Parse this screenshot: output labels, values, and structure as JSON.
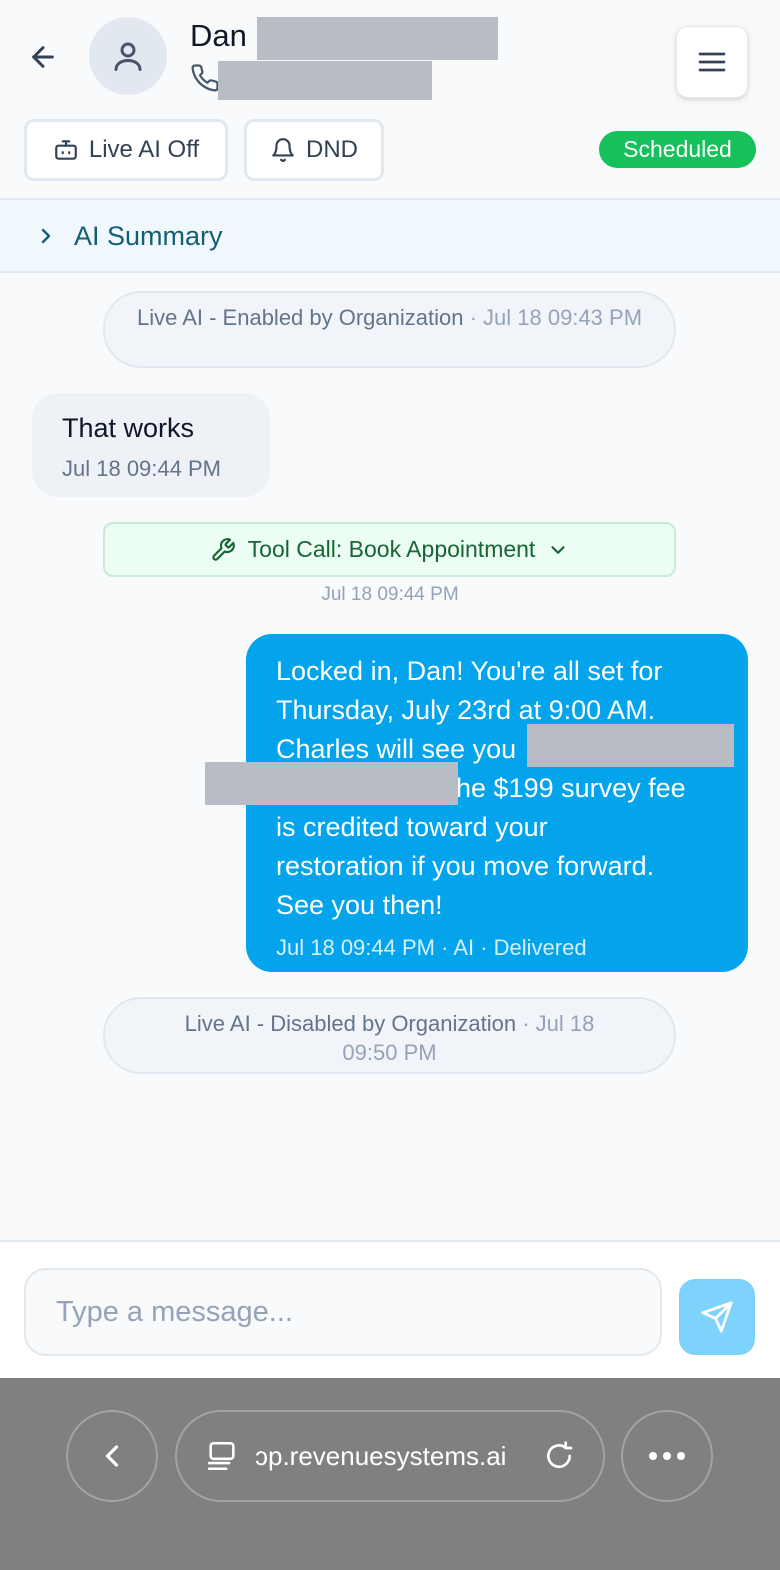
{
  "header": {
    "contact_name": "Dan",
    "buttons": {
      "live_ai": "Live AI Off",
      "dnd": "DND"
    },
    "status_badge": "Scheduled"
  },
  "ai_summary": {
    "label": "AI Summary"
  },
  "messages": {
    "system_1": {
      "text": "Live AI - Enabled by Organization",
      "time": "· Jul 18 09:43 PM"
    },
    "inbound_1": {
      "text": "That works",
      "time": "Jul 18 09:44 PM"
    },
    "tool_call": {
      "label": "Tool Call: Book Appointment",
      "time": "Jul 18 09:44 PM"
    },
    "outbound_1": {
      "text_line_1": "Locked in, Dan! You're all set for",
      "text_line_2": "Thursday, July 23rd at 9:00 AM.",
      "text_line_3": "Charles will see you",
      "text_line_4": "he $199 survey fee",
      "text_line_5": "is credited toward your",
      "text_line_6": "restoration if you move forward.",
      "text_line_7": "See you then!",
      "meta": "Jul 18 09:44 PM · AI · Delivered"
    },
    "system_2": {
      "text": "Live AI - Disabled by Organization",
      "time": "· Jul 18 09:50 PM"
    }
  },
  "composer": {
    "placeholder": "Type a message..."
  },
  "browser": {
    "url": "ɔp.revenuesystems.ai"
  },
  "colors": {
    "accent_blue": "#03a4ec",
    "scheduled_green": "#16c05a",
    "send_button": "#7dd3fc"
  },
  "icons": [
    "arrow-left-icon",
    "user-icon",
    "phone-icon",
    "hamburger-menu-icon",
    "bot-icon",
    "bell-icon",
    "chevron-right-icon",
    "wrench-icon",
    "chevron-down-icon",
    "send-icon",
    "browser-back-icon",
    "tabs-icon",
    "reload-icon",
    "more-icon"
  ]
}
